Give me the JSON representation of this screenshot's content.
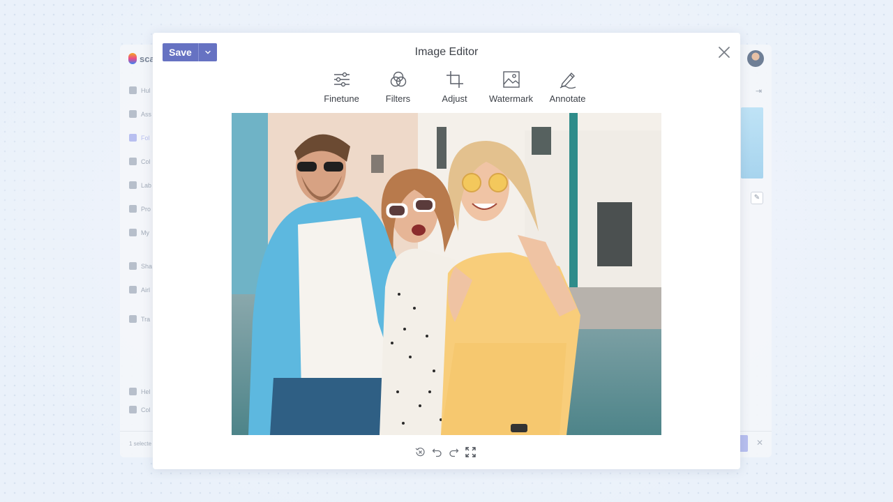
{
  "background": {
    "logo_text": "sca",
    "sidebar_items": [
      "Hul",
      "Ass",
      "Fol",
      "Col",
      "Lab",
      "Pro",
      "My",
      "Sha",
      "Airl",
      "Tra",
      "Hel",
      "Col"
    ],
    "footer_text": "1 selecte"
  },
  "editor": {
    "title": "Image Editor",
    "save_label": "Save",
    "tools": [
      {
        "label": "Finetune",
        "icon": "sliders-icon"
      },
      {
        "label": "Filters",
        "icon": "filters-icon"
      },
      {
        "label": "Adjust",
        "icon": "crop-icon"
      },
      {
        "label": "Watermark",
        "icon": "watermark-icon"
      },
      {
        "label": "Annotate",
        "icon": "pen-icon"
      }
    ],
    "bottom_controls": [
      "reset-icon",
      "undo-icon",
      "redo-icon",
      "fullscreen-icon"
    ]
  },
  "colors": {
    "accent": "#6672c2",
    "text": "#3d4148",
    "icon": "#5a5f68"
  }
}
